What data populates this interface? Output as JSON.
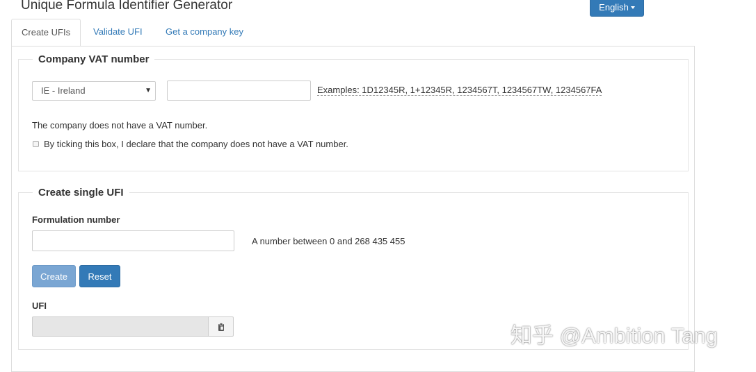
{
  "header": {
    "title": "Unique Formula Identifier Generator",
    "language_label": "English"
  },
  "tabs": [
    {
      "label": "Create UFIs",
      "active": true
    },
    {
      "label": "Validate UFI",
      "active": false
    },
    {
      "label": "Get a company key",
      "active": false
    }
  ],
  "vat_section": {
    "legend": "Company VAT number",
    "country_selected": "IE - Ireland",
    "vat_value": "",
    "examples": "Examples: 1D12345R, 1+12345R, 1234567T, 1234567TW, 1234567FA",
    "no_vat_text": "The company does not have a VAT number.",
    "checkbox_label": "By ticking this box, I declare that the company does not have a VAT number.",
    "checkbox_checked": false
  },
  "ufi_section": {
    "legend": "Create single UFI",
    "formulation_label": "Formulation number",
    "formulation_value": "",
    "formulation_hint": "A number between 0 and 268 435 455",
    "create_label": "Create",
    "reset_label": "Reset",
    "ufi_label": "UFI",
    "ufi_value": ""
  },
  "colors": {
    "primary": "#337ab7",
    "primary_disabled": "#7aa6d3",
    "link": "#337ab7"
  },
  "watermark": "知乎 @Ambition Tang"
}
